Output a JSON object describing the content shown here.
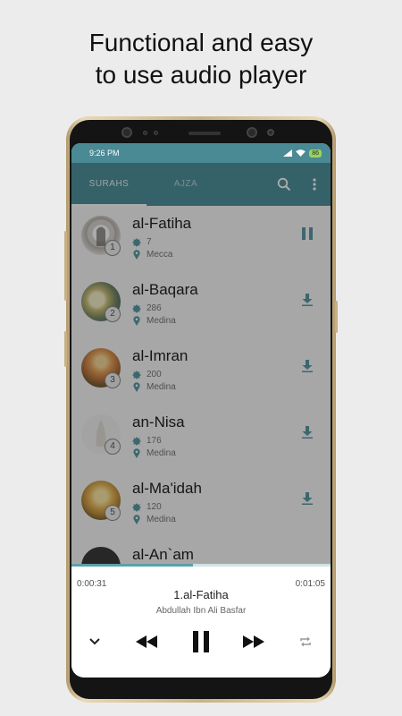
{
  "headline": {
    "line1": "Functional and easy",
    "line2": "to use audio player"
  },
  "status_bar": {
    "time": "9:26 PM",
    "battery": "86"
  },
  "tabs": [
    {
      "label": "SURAHS",
      "active": true
    },
    {
      "label": "AJZA",
      "active": false
    }
  ],
  "toolbar_icons": [
    "search-icon",
    "more-vert-icon"
  ],
  "surahs": [
    {
      "number": "1",
      "name": "al-Fatiha",
      "verses": "7",
      "place": "Mecca",
      "action": "pause-icon"
    },
    {
      "number": "2",
      "name": "al-Baqara",
      "verses": "286",
      "place": "Medina",
      "action": "download-icon"
    },
    {
      "number": "3",
      "name": "al-Imran",
      "verses": "200",
      "place": "Medina",
      "action": "download-icon"
    },
    {
      "number": "4",
      "name": "an-Nisa",
      "verses": "176",
      "place": "Medina",
      "action": "download-icon"
    },
    {
      "number": "5",
      "name": "al-Ma'idah",
      "verses": "120",
      "place": "Medina",
      "action": "download-icon"
    },
    {
      "number": "",
      "name": "al-An`am",
      "verses": "",
      "place": "",
      "action": ""
    }
  ],
  "player": {
    "current_time": "0:00:31",
    "total_time": "0:01:05",
    "progress": 0.47,
    "track_title": "1.al-Fatiha",
    "reciter": "Abdullah Ibn Ali Basfar",
    "controls": [
      "chevron-down-icon",
      "rewind-icon",
      "pause-icon",
      "fast-forward-icon",
      "repeat-icon"
    ]
  },
  "colors": {
    "accent": "#4f929c",
    "status_bar": "#4a8a94",
    "icon": "#5a9aa4",
    "progress": "#5aa0aa"
  }
}
